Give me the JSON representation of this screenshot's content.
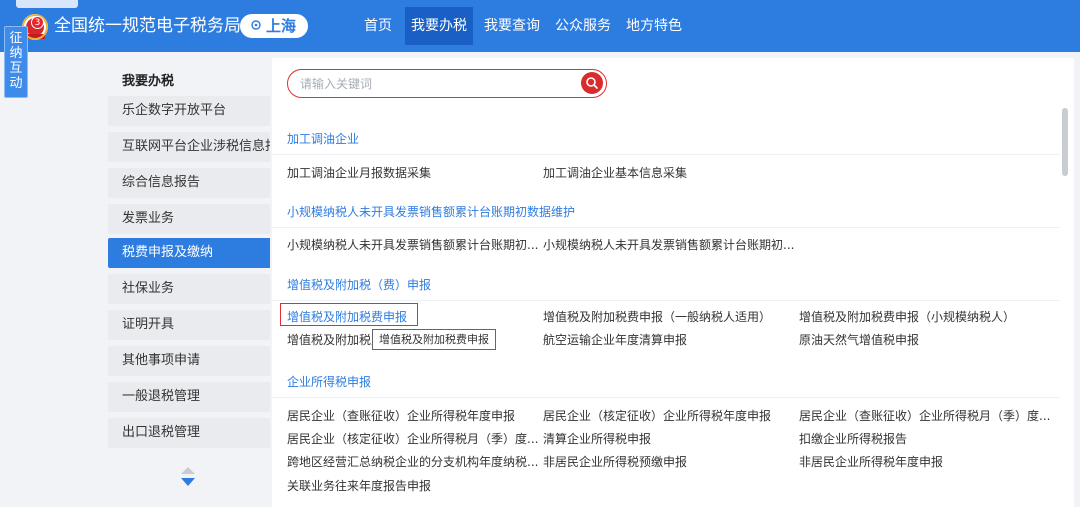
{
  "header": {
    "site_title": "全国统一规范电子税务局",
    "city": "上海",
    "badge_count": "3",
    "nav": [
      "首页",
      "我要办税",
      "我要查询",
      "公众服务",
      "地方特色"
    ],
    "active_nav": "我要办税",
    "brand_color": "#2d7ce0"
  },
  "vertical_tab": [
    "征",
    "纳",
    "互",
    "动"
  ],
  "sidenav": {
    "title": "我要办税",
    "items": [
      "乐企数字开放平台",
      "互联网平台企业涉税信息报送",
      "综合信息报告",
      "发票业务",
      "税费申报及缴纳",
      "社保业务",
      "证明开具",
      "其他事项申请",
      "一般退税管理",
      "出口退税管理"
    ],
    "active": "税费申报及缴纳"
  },
  "search": {
    "placeholder": "请输入关键词",
    "icon": "search-icon"
  },
  "sections": [
    {
      "title": "加工调油企业",
      "rows": [
        [
          "加工调油企业月报数据采集",
          "加工调油企业基本信息采集"
        ]
      ]
    },
    {
      "title": "小规模纳税人未开具发票销售额累计台账期初数据维护",
      "rows": [
        [
          "小规模纳税人未开具发票销售额累计台账期初...",
          "小规模纳税人未开具发票销售额累计台账期初..."
        ]
      ]
    },
    {
      "title": "增值税及附加税（费）申报",
      "rows": [
        [
          "增值税及附加税费申报",
          "增值税及附加税费申报（一般纳税人适用）",
          "增值税及附加税费申报（小规模纳税人）"
        ],
        [
          "增值税及附加税费",
          "航空运输企业年度清算申报",
          "原油天然气增值税申报"
        ]
      ]
    },
    {
      "title": "企业所得税申报",
      "rows": [
        [
          "居民企业（查账征收）企业所得税年度申报",
          "居民企业（核定征收）企业所得税年度申报",
          "居民企业（查账征收）企业所得税月（季）度..."
        ],
        [
          "居民企业（核定征收）企业所得税月（季）度...",
          "清算企业所得税申报",
          "扣缴企业所得税报告"
        ],
        [
          "跨地区经营汇总纳税企业的分支机构年度纳税...",
          "非居民企业所得税预缴申报",
          "非居民企业所得税年度申报"
        ],
        [
          "关联业务往来年度报告申报"
        ]
      ]
    }
  ],
  "tooltip": "增值税及附加税费申报",
  "highlight_color": "#e03131"
}
